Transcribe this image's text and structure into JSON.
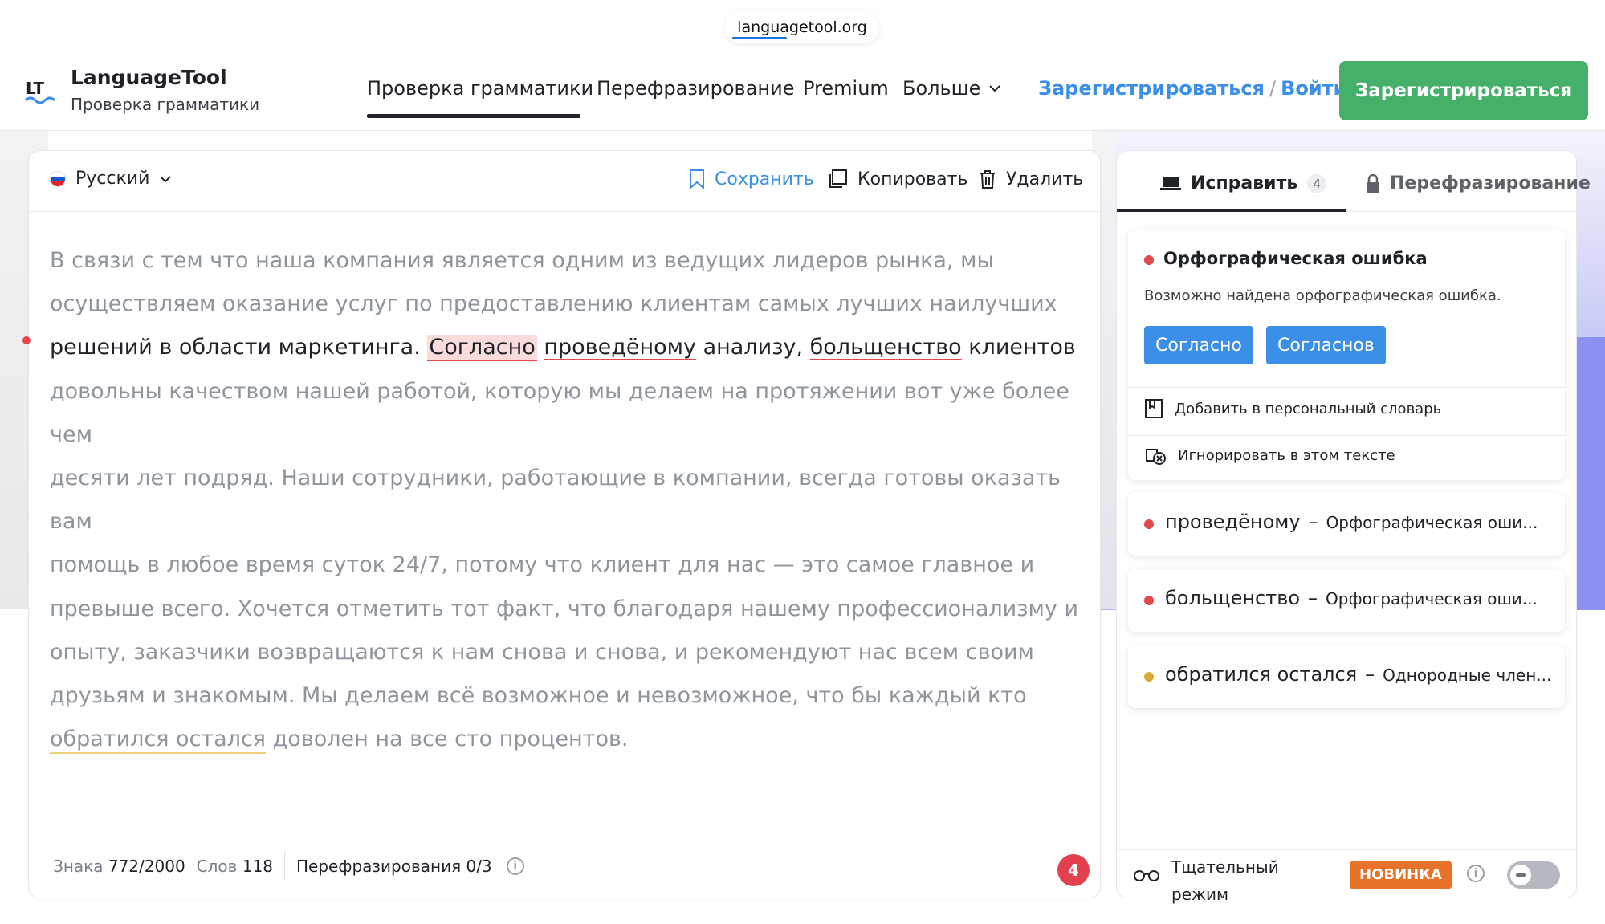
{
  "browser": {
    "url": "languagetool.org"
  },
  "header": {
    "brand_name": "LanguageTool",
    "brand_sub": "Проверка грамматики",
    "nav": [
      "Проверка грамматики",
      "Перефразирование",
      "Premium",
      "Больше"
    ],
    "register_link": "Зарегистрироваться",
    "login_link": "Войти",
    "register_button": "Зарегистрироваться"
  },
  "editor": {
    "language": "Русский",
    "save": "Сохранить",
    "copy": "Копировать",
    "delete": "Удалить",
    "text": {
      "p1": "В связи с тем что наша компания является одним из ведущих лидеров рынка, мы",
      "p2": "осуществляем оказание услуг по предоставлению клиентам самых лучших наилучших",
      "p3a": "решений в области маркетинга. ",
      "e1": "Согласно",
      "e2": "проведёному",
      "p3b": " анализу, ",
      "e3": "больщенство",
      "p3c": " клиентов",
      "p4": "довольны качеством нашей работой, которую мы делаем на протяжении вот уже более чем",
      "p5": "десяти лет подряд. Наши сотрудники, работающие в компании, всегда готовы оказать вам",
      "p6": "помощь в любое время суток 24/7, потому что клиент для нас — это самое главное и",
      "p7": "превыше всего. Хочется отметить тот факт, что благодаря нашему профессионализму и",
      "p8": "опыту, заказчики возвращаются к нам снова и снова, и рекомендуют нас всем своим",
      "p9": "друзьям и знакомым. Мы делаем всё возможное и невозможное, что бы каждый кто",
      "e4": "обратился остался",
      "p10": " доволен на все сто процентов."
    },
    "footer": {
      "chars_label": "Знака",
      "chars_value": "772/2000",
      "words_label": "Слов",
      "words_value": "118",
      "rephrase_label": "Перефразирования",
      "rephrase_value": "0/3",
      "error_count": "4"
    }
  },
  "sidebar": {
    "tab_fix": "Исправить",
    "tab_fix_count": "4",
    "tab_rephrase": "Перефразирование",
    "active_card": {
      "title": "Орфографическая ошибка",
      "description": "Возможно найдена орфографическая ошибка.",
      "suggestions": [
        "Согласно",
        "Согласнов"
      ],
      "add_dictionary": "Добавить в персональный словарь",
      "ignore": "Игнорировать в этом тексте"
    },
    "issues": [
      {
        "word": "проведёному",
        "category": "Орфографическая оши...",
        "color": "#e2474c"
      },
      {
        "word": "больщенство",
        "category": "Орфографическая оши...",
        "color": "#e2474c"
      },
      {
        "word": "обратился остался",
        "category": "Однородные член...",
        "color": "#d6a93a"
      }
    ],
    "footer": {
      "thorough_line1": "Тщательный",
      "thorough_line2": "режим",
      "new_badge": "НОВИНКА"
    }
  },
  "colors": {
    "accent_blue": "#3b8fe8",
    "brand_green": "#45b06a",
    "error_red": "#e2474c",
    "style_yellow": "#d6a93a",
    "new_orange": "#e8722a"
  }
}
